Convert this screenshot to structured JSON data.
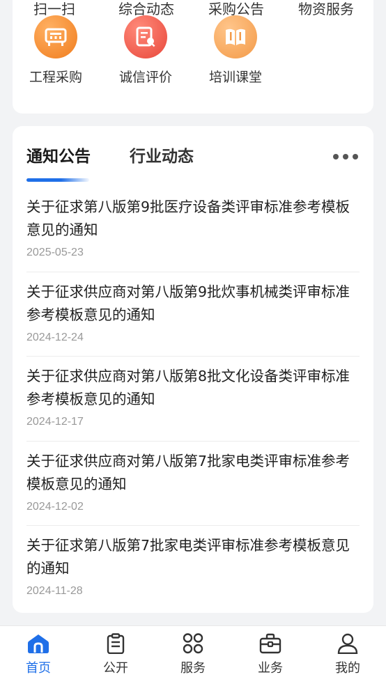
{
  "quick_top": [
    "扫一扫",
    "综合动态",
    "采购公告",
    "物资服务"
  ],
  "quick_icons": [
    {
      "label": "工程采购",
      "icon": "construction-purchase-icon",
      "color": "#f38a2b"
    },
    {
      "label": "诚信评价",
      "icon": "credit-evaluation-icon",
      "color": "#ec5a46"
    },
    {
      "label": "培训课堂",
      "icon": "training-book-icon",
      "color": "#f5a35a"
    }
  ],
  "news": {
    "tabs": [
      "通知公告",
      "行业动态"
    ],
    "more_icon": "more-dots-icon",
    "items": [
      {
        "title": "关于征求第八版第9批医疗设备类评审标准参考模板意见的通知",
        "date": "2025-05-23"
      },
      {
        "title": "关于征求供应商对第八版第9批炊事机械类评审标准参考模板意见的通知",
        "date": "2024-12-24"
      },
      {
        "title": "关于征求供应商对第八版第8批文化设备类评审标准参考模板意见的通知",
        "date": "2024-12-17"
      },
      {
        "title": "关于征求供应商对第八版第7批家电类评审标准参考模板意见的通知",
        "date": "2024-12-02"
      },
      {
        "title": "关于征求第八版第7批家电类评审标准参考模板意见的通知",
        "date": "2024-11-28"
      }
    ]
  },
  "tabbar": {
    "active_color": "#1f6fe8",
    "items": [
      {
        "label": "首页",
        "icon": "home-icon",
        "active": true
      },
      {
        "label": "公开",
        "icon": "clipboard-icon",
        "active": false
      },
      {
        "label": "服务",
        "icon": "services-grid-icon",
        "active": false
      },
      {
        "label": "业务",
        "icon": "briefcase-icon",
        "active": false
      },
      {
        "label": "我的",
        "icon": "user-icon",
        "active": false
      }
    ]
  }
}
